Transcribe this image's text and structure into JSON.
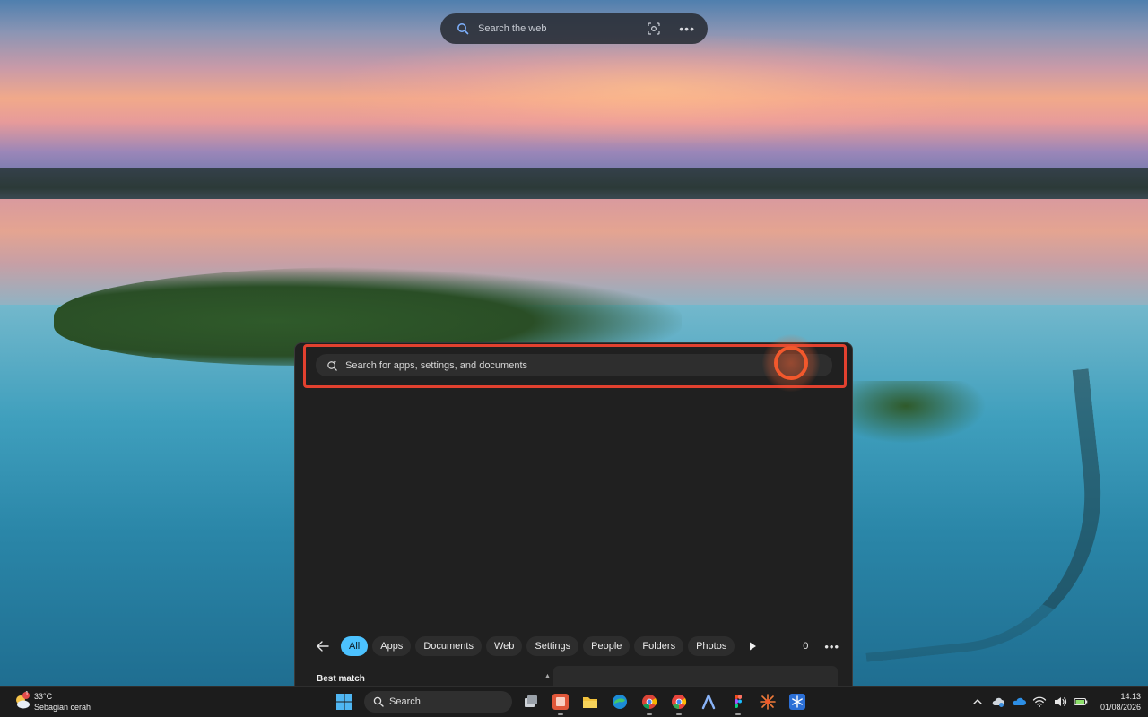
{
  "web_search": {
    "placeholder": "Search the web",
    "search_icon": "search-icon",
    "visual_search_icon": "visual-search-icon",
    "more_icon": "more-horizontal-icon"
  },
  "start_search": {
    "placeholder": "Search for apps, settings, and documents",
    "search_icon": "search-spark-icon",
    "highlight_color": "#e2412f",
    "click_marker_color": "#f2582c"
  },
  "filters": {
    "back_icon": "back-arrow-icon",
    "items": [
      {
        "label": "All",
        "active": true
      },
      {
        "label": "Apps",
        "active": false
      },
      {
        "label": "Documents",
        "active": false
      },
      {
        "label": "Web",
        "active": false
      },
      {
        "label": "Settings",
        "active": false
      },
      {
        "label": "People",
        "active": false
      },
      {
        "label": "Folders",
        "active": false
      },
      {
        "label": "Photos",
        "active": false
      }
    ],
    "more_filters_icon": "play-icon",
    "rewards_count": "0",
    "options_icon": "more-horizontal-icon",
    "accent_color": "#4cc2ff"
  },
  "results": {
    "best_match_label": "Best match"
  },
  "taskbar": {
    "weather": {
      "temperature": "33°C",
      "condition": "Sebagian cerah",
      "badge": "1",
      "icon": "partly-sunny-icon"
    },
    "start_icon": "windows-logo-icon",
    "search_label": "Search",
    "apps": [
      {
        "name": "task-view-icon"
      },
      {
        "name": "powerpoint-icon"
      },
      {
        "name": "file-explorer-icon"
      },
      {
        "name": "edge-icon"
      },
      {
        "name": "chrome-icon"
      },
      {
        "name": "chrome-canary-icon"
      },
      {
        "name": "arc-icon"
      },
      {
        "name": "figma-icon"
      },
      {
        "name": "burst-app-icon"
      },
      {
        "name": "snowflake-app-icon"
      }
    ],
    "tray": [
      {
        "name": "chevron-up-icon"
      },
      {
        "name": "cloud-sync-icon"
      },
      {
        "name": "onedrive-icon"
      },
      {
        "name": "wifi-icon"
      },
      {
        "name": "volume-icon"
      },
      {
        "name": "battery-icon"
      }
    ],
    "time": "14:13",
    "date": "01/08/2026"
  }
}
